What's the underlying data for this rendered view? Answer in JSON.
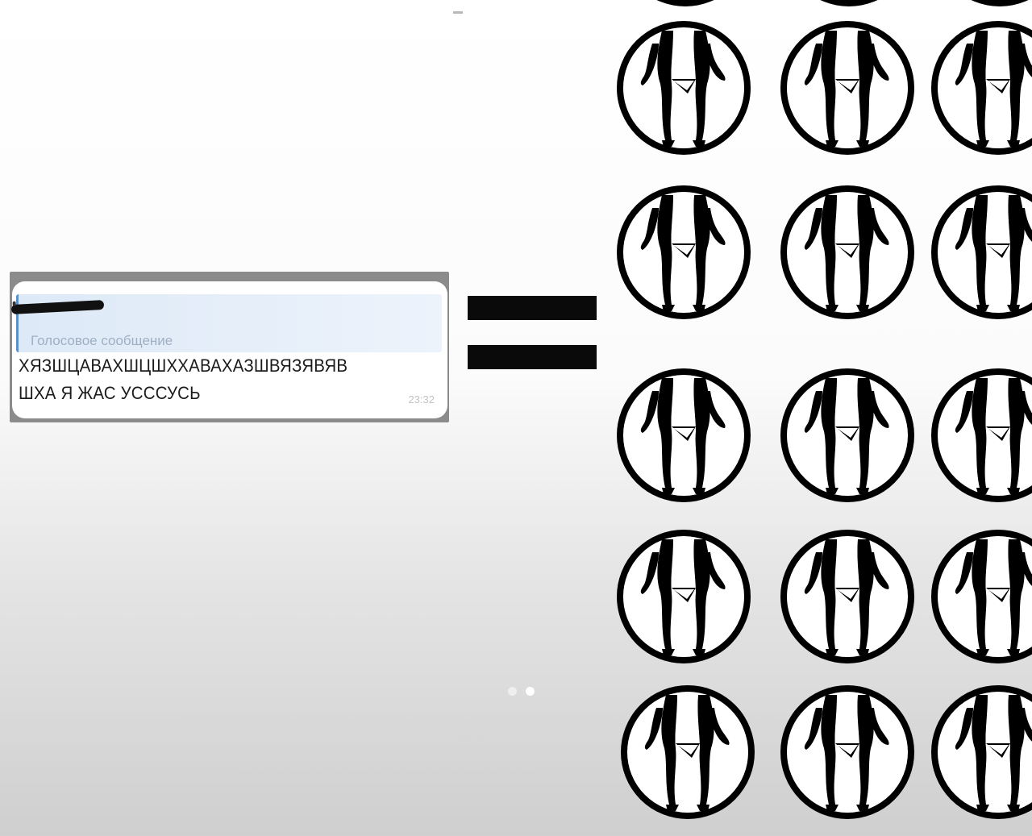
{
  "message": {
    "quote_label": "Голосовое сообщение",
    "text": "ХЯЗШЦАВАХШЦШХХАВАХАЗШВЯЗЯВЯВ\nШХА Я ЖАС УСССУСЬ",
    "time": "23:32"
  },
  "pager": {
    "total": 2,
    "active_index": 1
  },
  "emblem_grid": {
    "rows": 5,
    "columns_visible": 3,
    "icon": "legs-in-circle-icon"
  }
}
